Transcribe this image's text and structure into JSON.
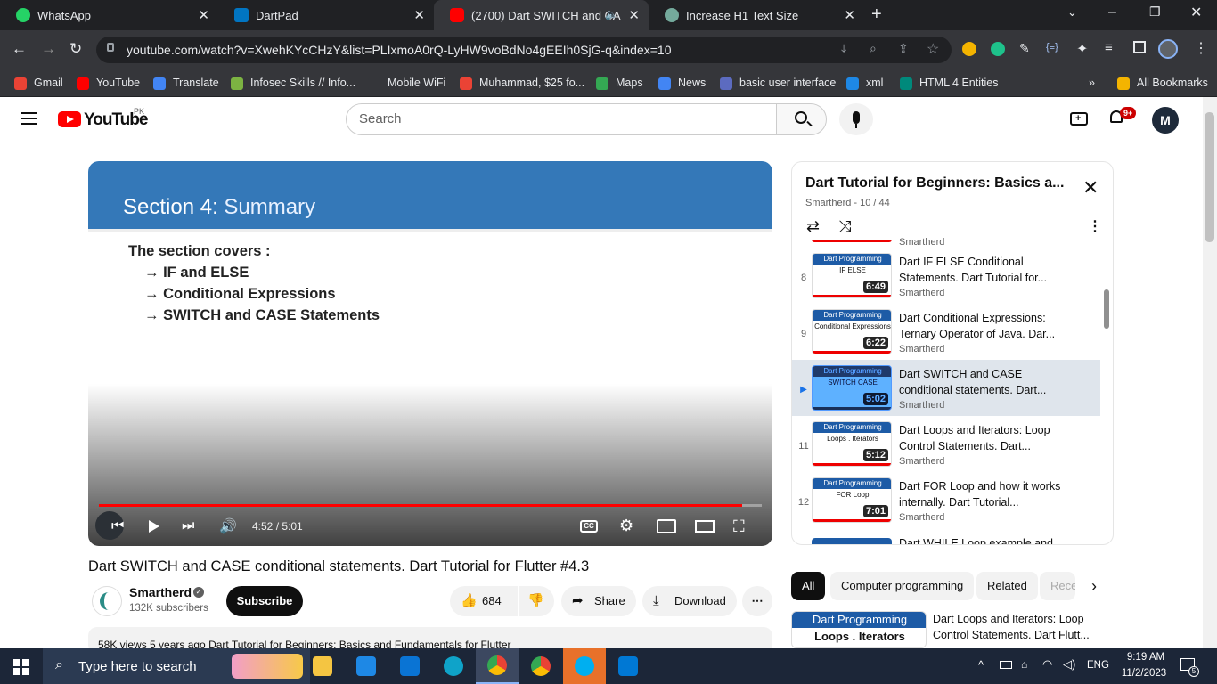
{
  "browser": {
    "tabs": [
      {
        "title": "WhatsApp",
        "favicon": "whatsapp-icon",
        "color": "#25d366"
      },
      {
        "title": "DartPad",
        "favicon": "dart-icon",
        "color": "#0175c2"
      },
      {
        "title": "(2700) Dart SWITCH and CA",
        "favicon": "youtube-icon",
        "color": "#ff0000"
      },
      {
        "title": "Increase H1 Text Size",
        "favicon": "chatgpt-icon",
        "color": "#74aa9c"
      }
    ],
    "url": "youtube.com/watch?v=XwehKYcCHzY&list=PLIxmoA0rQ-LyHW9voBdNo4gEEIh0SjG-q&index=10",
    "bookmarks": [
      {
        "label": "Gmail",
        "color": "#ea4335"
      },
      {
        "label": "YouTube",
        "color": "#ff0000"
      },
      {
        "label": "Translate",
        "color": "#4285f4"
      },
      {
        "label": "Infosec Skills // Info...",
        "color": "#7cb342"
      },
      {
        "label": "Mobile WiFi",
        "color": "#35363a"
      },
      {
        "label": "Muhammad, $25 fo...",
        "color": "#ea4335"
      },
      {
        "label": "Maps",
        "color": "#34a853"
      },
      {
        "label": "News",
        "color": "#4285f4"
      },
      {
        "label": "basic user interface",
        "color": "#5c6bc0"
      },
      {
        "label": "xml",
        "color": "#1e88e5"
      },
      {
        "label": "HTML 4 Entities",
        "color": "#00897b"
      }
    ],
    "all_bookmarks": "All Bookmarks",
    "more_bookmarks": "»"
  },
  "youtube": {
    "logo_text": "YouTube",
    "region": "PK",
    "search_placeholder": "Search",
    "notification_count": "9+",
    "video": {
      "slide_heading_bold": "Section 4:",
      "slide_heading_rest": " Summary",
      "slide_intro": "The section covers :",
      "slide_points": [
        "IF and ELSE",
        "Conditional Expressions",
        "SWITCH and CASE Statements"
      ],
      "time": "4:52 / 5:01",
      "progress": 0.97,
      "title": "Dart SWITCH and CASE conditional statements. Dart Tutorial for Flutter #4.3",
      "channel": "Smartherd",
      "subscribers": "132K subscribers",
      "subscribe_label": "Subscribe",
      "likes": "684",
      "share_label": "Share",
      "download_label": "Download",
      "description": "58K views  5 years ago  Dart Tutorial for Beginners: Basics and Fundamentals for Flutter"
    },
    "playlist": {
      "title": "Dart Tutorial for Beginners: Basics a...",
      "subtitle": "Smartherd - 10 / 44",
      "partial_channel": "Smartherd",
      "items": [
        {
          "num": "8",
          "thumb_top": "Dart Programming",
          "thumb_main": "IF ELSE",
          "duration": "6:49",
          "title": "Dart IF ELSE Conditional Statements. Dart Tutorial for...",
          "channel": "Smartherd"
        },
        {
          "num": "9",
          "thumb_top": "Dart Programming",
          "thumb_main": "Conditional Expressions",
          "duration": "6:22",
          "title": "Dart Conditional Expressions: Ternary Operator of Java. Dar...",
          "channel": "Smartherd"
        },
        {
          "num": "▶",
          "thumb_top": "Dart Programming",
          "thumb_main": "SWITCH  CASE",
          "duration": "5:02",
          "title": "Dart SWITCH and CASE conditional statements. Dart...",
          "channel": "Smartherd"
        },
        {
          "num": "11",
          "thumb_top": "Dart Programming",
          "thumb_main": "Loops . Iterators",
          "duration": "5:12",
          "title": "Dart Loops and Iterators: Loop Control Statements. Dart...",
          "channel": "Smartherd"
        },
        {
          "num": "12",
          "thumb_top": "Dart Programming",
          "thumb_main": "FOR Loop",
          "duration": "7:01",
          "title": "Dart FOR Loop and how it works internally. Dart Tutorial...",
          "channel": "Smartherd"
        }
      ],
      "partial_next": "Dart WHILE Loop example and"
    },
    "chips": [
      "All",
      "Computer programming",
      "Related",
      "Rece"
    ],
    "rec": {
      "thumb_top": "Dart Programming",
      "thumb_main": "Loops . Iterators",
      "title": "Dart Loops and Iterators: Loop Control Statements. Dart Flutt..."
    }
  },
  "taskbar": {
    "search_placeholder": "Type here to search",
    "lang": "ENG",
    "time": "9:19 AM",
    "date": "11/2/2023",
    "notifications": "5"
  }
}
